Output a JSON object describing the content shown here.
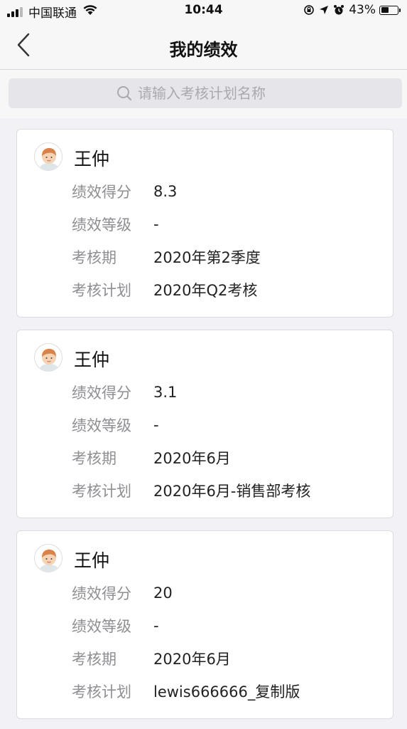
{
  "status_bar": {
    "carrier": "中国联通",
    "time": "10:44",
    "battery_percent": "43%"
  },
  "nav": {
    "title": "我的绩效"
  },
  "search": {
    "placeholder": "请输入考核计划名称"
  },
  "labels": {
    "score": "绩效得分",
    "grade": "绩效等级",
    "period": "考核期",
    "plan": "考核计划"
  },
  "records": [
    {
      "name": "王仲",
      "score": "8.3",
      "grade": "-",
      "period": "2020年第2季度",
      "plan": "2020年Q2考核"
    },
    {
      "name": "王仲",
      "score": "3.1",
      "grade": "-",
      "period": "2020年6月",
      "plan": "2020年6月-销售部考核"
    },
    {
      "name": "王仲",
      "score": "20",
      "grade": "-",
      "period": "2020年6月",
      "plan": "lewis666666_复制版"
    }
  ]
}
